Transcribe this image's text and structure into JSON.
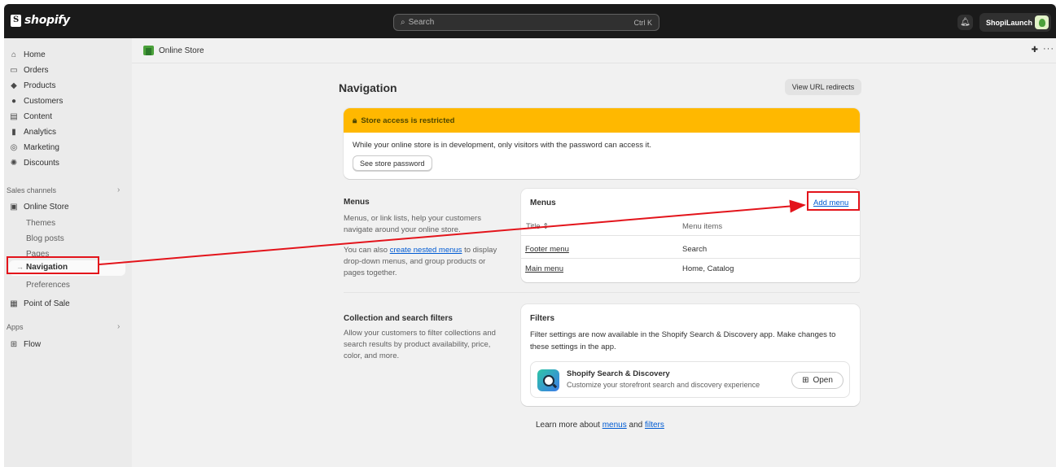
{
  "topbar": {
    "brand": "shopify",
    "search_placeholder": "Search",
    "search_shortcut": "Ctrl K",
    "store_name": "ShopiLaunch"
  },
  "sidebar": {
    "items": [
      {
        "label": "Home",
        "icon": "home-icon"
      },
      {
        "label": "Orders",
        "icon": "inbox-icon"
      },
      {
        "label": "Products",
        "icon": "tag-icon"
      },
      {
        "label": "Customers",
        "icon": "person-icon"
      },
      {
        "label": "Content",
        "icon": "content-icon"
      },
      {
        "label": "Analytics",
        "icon": "bar-chart-icon"
      },
      {
        "label": "Marketing",
        "icon": "target-icon"
      },
      {
        "label": "Discounts",
        "icon": "discount-icon"
      }
    ],
    "sales_channels_label": "Sales channels",
    "online_store": "Online Store",
    "online_store_sub": [
      "Themes",
      "Blog posts",
      "Pages",
      "Navigation",
      "Preferences"
    ],
    "point_of_sale": "Point of Sale",
    "apps_label": "Apps",
    "flow": "Flow"
  },
  "breadcrumb": {
    "label": "Online Store"
  },
  "page": {
    "title": "Navigation",
    "redirects_button": "View URL redirects"
  },
  "banner": {
    "title": "Store access is restricted",
    "body": "While your online store is in development, only visitors with the password can access it.",
    "button": "See store password",
    "color": "#ffb800"
  },
  "menus_section": {
    "title": "Menus",
    "desc1": "Menus, or link lists, help your customers navigate around your online store.",
    "desc2_pre": "You can also ",
    "desc2_link": "create nested menus",
    "desc2_post": " to display drop-down menus, and group products or pages together.",
    "card_title": "Menus",
    "add_menu": "Add menu",
    "col_title": "Title",
    "col_items": "Menu items",
    "rows": [
      {
        "title": "Footer menu",
        "items": "Search"
      },
      {
        "title": "Main menu",
        "items": "Home, Catalog"
      }
    ]
  },
  "filters_section": {
    "title": "Collection and search filters",
    "desc": "Allow your customers to filter collections and search results by product availability, price, color, and more.",
    "card_title": "Filters",
    "card_desc": "Filter settings are now available in the Shopify Search & Discovery app. Make changes to these settings in the app.",
    "app_name": "Shopify Search & Discovery",
    "app_desc": "Customize your storefront search and discovery experience",
    "open_button": "Open"
  },
  "footer": {
    "pre": "Learn more about ",
    "link1": "menus",
    "mid": " and ",
    "link2": "filters"
  },
  "annotation_color": "#e3141b"
}
